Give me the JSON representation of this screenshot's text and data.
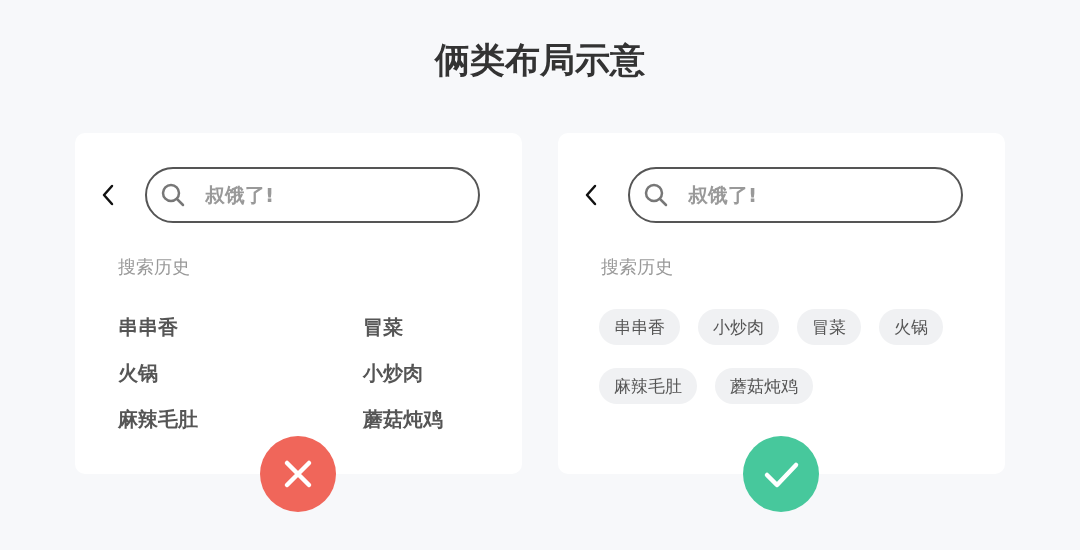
{
  "title": "俩类布局示意",
  "panels": [
    {
      "search": {
        "placeholder": "叔饿了!"
      },
      "history": {
        "kind": "list",
        "label": "搜索历史",
        "items": [
          "串串香",
          "冒菜",
          "火锅",
          "小炒肉",
          "麻辣毛肚",
          "蘑菇炖鸡"
        ]
      },
      "badge": {
        "kind": "cross"
      }
    },
    {
      "search": {
        "placeholder": "叔饿了!"
      },
      "history": {
        "kind": "chips",
        "label": "搜索历史",
        "items": [
          "串串香",
          "小炒肉",
          "冒菜",
          "火锅",
          "麻辣毛肚",
          "蘑菇炖鸡"
        ]
      },
      "badge": {
        "kind": "check"
      }
    }
  ]
}
